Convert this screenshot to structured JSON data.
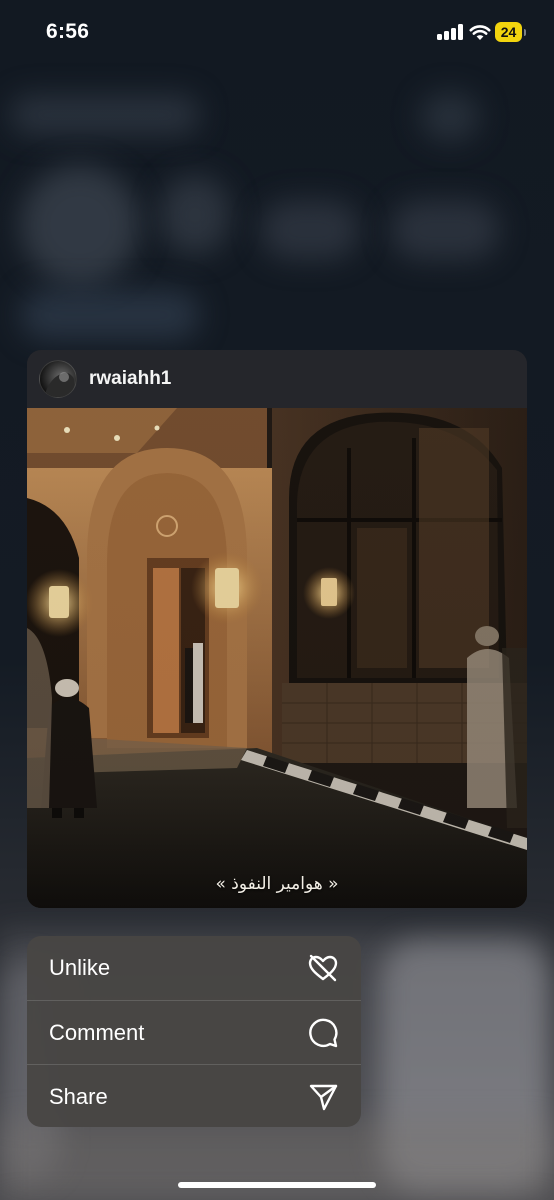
{
  "status_bar": {
    "time": "6:56",
    "battery_level": "24",
    "battery_color": "#f2d40e",
    "icons": [
      "signal-icon",
      "wifi-icon",
      "battery-icon"
    ]
  },
  "post_preview": {
    "username": "rwaiahh1",
    "avatar_icon": "avatar",
    "photo_caption": "« هوامير النفوذ »"
  },
  "context_menu": {
    "items": [
      {
        "label": "Unlike",
        "icon": "unlike-heart-icon"
      },
      {
        "label": "Comment",
        "icon": "comment-bubble-icon"
      },
      {
        "label": "Share",
        "icon": "paper-plane-icon"
      }
    ]
  }
}
